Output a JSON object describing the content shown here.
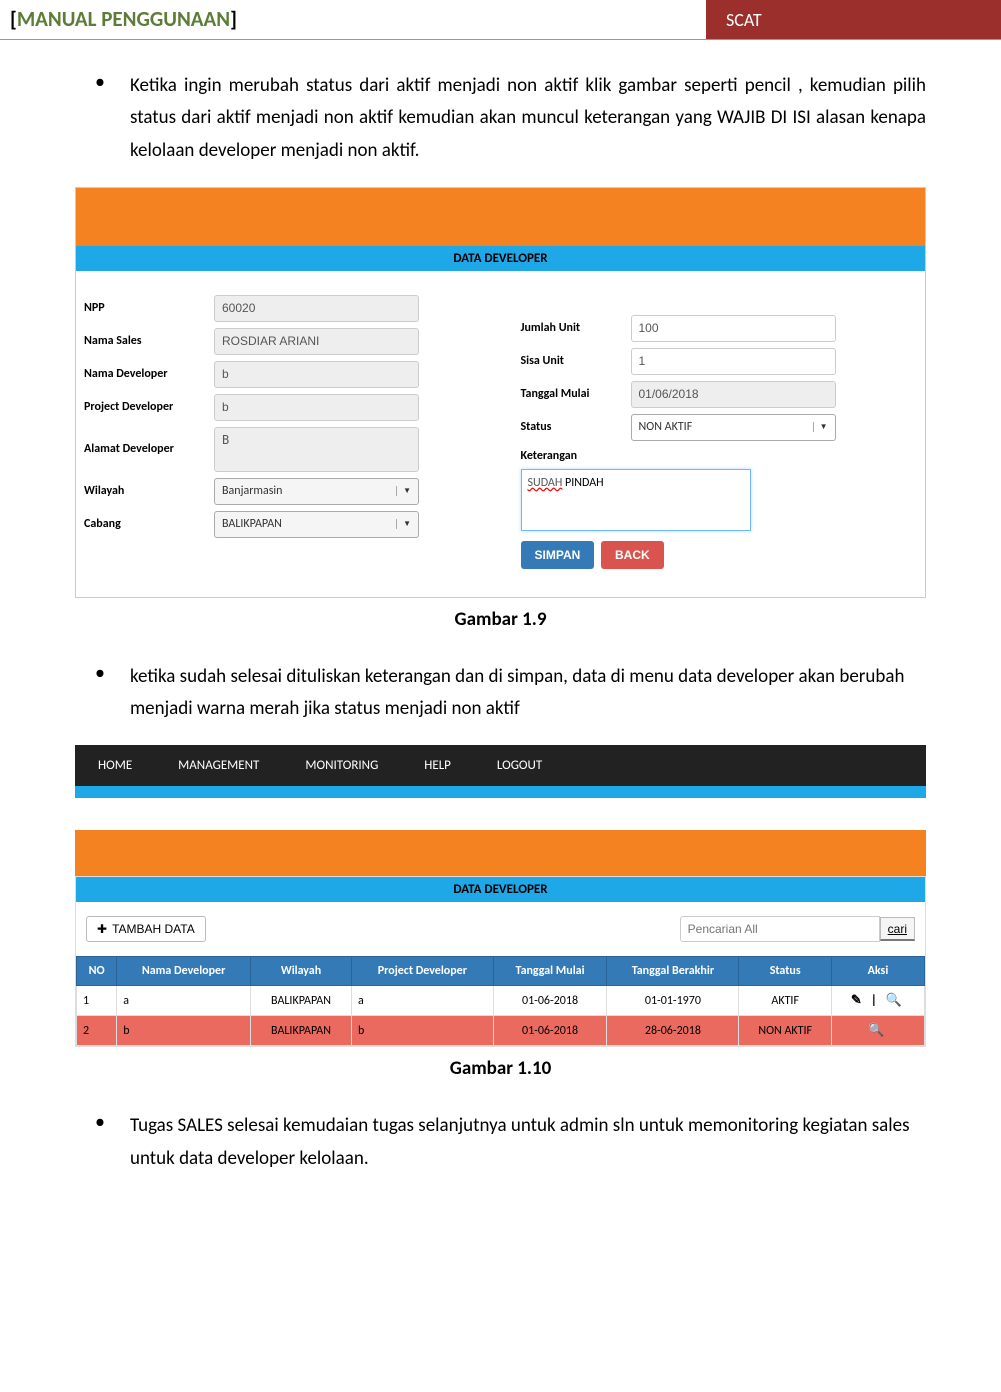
{
  "header": {
    "left_bracket_open": "[",
    "title": "MANUAL PENGGUNAAN",
    "left_bracket_close": "]",
    "right": "SCAT"
  },
  "bullets": {
    "b1": "Ketika ingin merubah status dari aktif menjadi non aktif klik gambar seperti pencil , kemudian pilih status dari aktif menjadi non aktif  kemudian akan muncul keterangan yang WAJIB DI ISI  alasan kenapa kelolaan developer menjadi non aktif.",
    "b2": "ketika sudah selesai dituliskan keterangan dan di simpan, data di menu data developer akan berubah menjadi warna merah jika status menjadi non aktif",
    "b3": "Tugas SALES  selesai  kemudaian tugas selanjutnya untuk admin sln untuk memonitoring kegiatan sales untuk data developer kelolaan."
  },
  "captions": {
    "c1": "Gambar 1.9",
    "c2": "Gambar 1.10"
  },
  "shot1": {
    "banner": "DATA DEVELOPER",
    "labels": {
      "npp": "NPP",
      "nama_sales": "Nama Sales",
      "nama_dev": "Nama Developer",
      "project_dev": "Project Developer",
      "alamat_dev": "Alamat Developer",
      "wilayah": "Wilayah",
      "cabang": "Cabang",
      "jumlah_unit": "Jumlah Unit",
      "sisa_unit": "Sisa Unit",
      "tgl_mulai": "Tanggal Mulai",
      "status": "Status",
      "keterangan": "Keterangan"
    },
    "values": {
      "npp": "60020",
      "nama_sales": "ROSDIAR ARIANI",
      "nama_dev": "b",
      "project_dev": "b",
      "alamat_dev": "B",
      "wilayah": "Banjarmasin",
      "cabang": "BALIKPAPAN",
      "jumlah_unit": "100",
      "sisa_unit": "1",
      "tgl_mulai": "01/06/2018",
      "status": "NON AKTIF",
      "keterangan_prefix": "SUDAH",
      "keterangan_suffix": " PINDAH"
    },
    "buttons": {
      "simpan": "SIMPAN",
      "back": "BACK"
    }
  },
  "shot2": {
    "nav": [
      "HOME",
      "MANAGEMENT",
      "MONITORING",
      "HELP",
      "LOGOUT"
    ],
    "banner": "DATA DEVELOPER",
    "tambah": "TAMBAH DATA",
    "search_ph": "Pencarian All",
    "cari": "cari",
    "headers": [
      "NO",
      "Nama Developer",
      "Wilayah",
      "Project Developer",
      "Tanggal Mulai",
      "Tanggal Berakhir",
      "Status",
      "Aksi"
    ],
    "rows": [
      {
        "no": "1",
        "nama": "a",
        "wil": "BALIKPAPAN",
        "proj": "a",
        "mulai": "01-06-2018",
        "akhir": "01-01-1970",
        "status": "AKTIF",
        "aksi": "✎ | 🔍",
        "cls": ""
      },
      {
        "no": "2",
        "nama": "b",
        "wil": "BALIKPAPAN",
        "proj": "b",
        "mulai": "01-06-2018",
        "akhir": "28-06-2018",
        "status": "NON AKTIF",
        "aksi": "🔍",
        "cls": "row-red"
      }
    ]
  }
}
